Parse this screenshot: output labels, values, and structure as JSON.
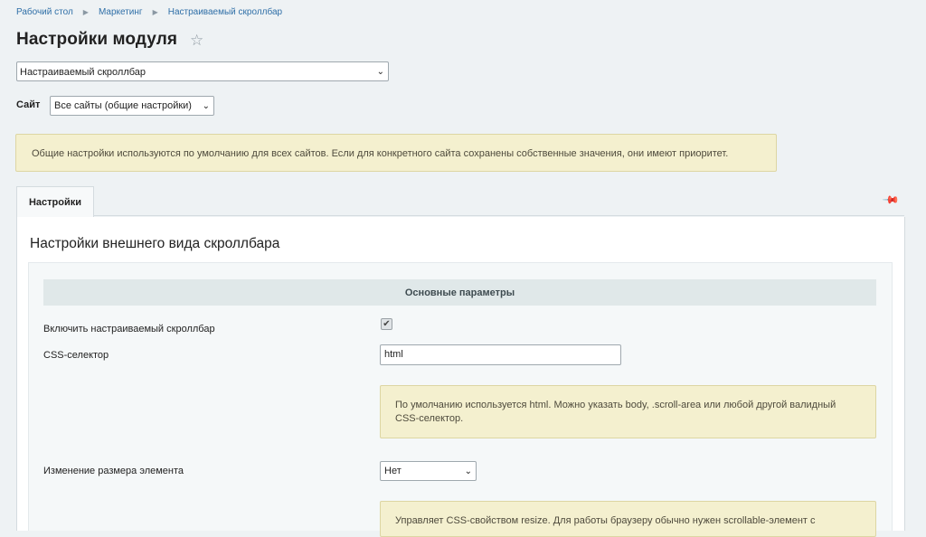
{
  "breadcrumbs": [
    "Рабочий стол",
    "Маркетинг",
    "Настраиваемый скроллбар"
  ],
  "page_title": "Настройки модуля",
  "module_select": {
    "value": "Настраиваемый скроллбар"
  },
  "site": {
    "label": "Сайт",
    "value": "Все сайты (общие настройки)"
  },
  "info_note": "Общие настройки используются по умолчанию для всех сайтов. Если для конкретного сайта сохранены собственные значения, они имеют приоритет.",
  "tabs": [
    {
      "label": "Настройки"
    }
  ],
  "panel": {
    "title": "Настройки внешнего вида скроллбара",
    "section_header": "Основные параметры",
    "rows": {
      "enable": {
        "label": "Включить настраиваемый скроллбар",
        "checked": true
      },
      "css_selector": {
        "label": "CSS-селектор",
        "value": "html"
      },
      "css_hint": "По умолчанию используется html. Можно указать body, .scroll-area или любой другой валидный CSS-селектор.",
      "resize": {
        "label": "Изменение размера элемента",
        "value": "Нет"
      },
      "resize_hint": "Управляет CSS-свойством resize. Для работы браузеру обычно нужен scrollable-элемент с"
    }
  },
  "colors": {
    "background": "#eef2f4",
    "link": "#2f6fa7",
    "note_background": "#f4f0cf",
    "section_header_background": "#e0e8e9"
  },
  "icons": {
    "favorite": "star-icon",
    "pin": "pin-icon",
    "dropdown": "chevron-down-icon"
  }
}
